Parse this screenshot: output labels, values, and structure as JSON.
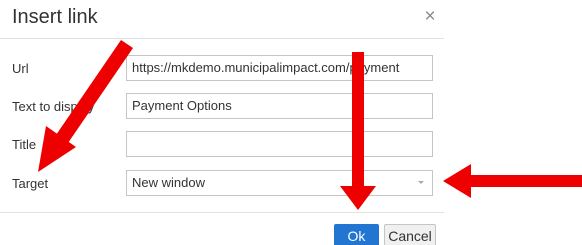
{
  "dialog": {
    "title": "Insert link",
    "close_icon": "close-icon"
  },
  "form": {
    "url": {
      "label": "Url",
      "value": "https://mkdemo.municipalimpact.com/payment"
    },
    "text_to_display": {
      "label": "Text to display",
      "value": "Payment Options"
    },
    "title": {
      "label": "Title",
      "value": ""
    },
    "target": {
      "label": "Target",
      "value": "New window",
      "icon": "chevron-down-icon"
    }
  },
  "buttons": {
    "ok_label": "Ok",
    "cancel_label": "Cancel"
  },
  "colors": {
    "accent": "#2276d2",
    "annotation_arrow": "#ee0000"
  }
}
